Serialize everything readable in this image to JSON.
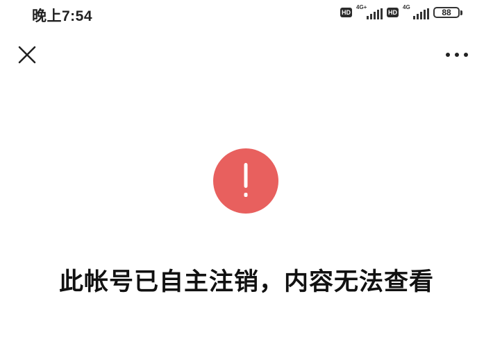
{
  "status_bar": {
    "time": "晚上7:54",
    "hd_label": "HD",
    "sim1_network": "4G+",
    "sim2_network": "4G",
    "battery": "88"
  },
  "nav": {
    "close_icon": "close-icon",
    "more_icon": "more-horizontal-icon"
  },
  "content": {
    "icon": "exclamation-icon",
    "icon_color": "#e8605e",
    "message": "此帐号已自主注销，内容无法查看"
  }
}
